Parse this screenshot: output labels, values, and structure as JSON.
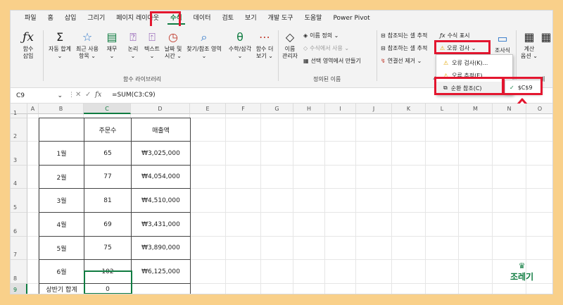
{
  "menu": [
    "파일",
    "홈",
    "삽입",
    "그리기",
    "페이지 레이아웃",
    "수식",
    "데이터",
    "검토",
    "보기",
    "개발 도구",
    "도움말",
    "Power Pivot"
  ],
  "active_menu": "수식",
  "ribbon": {
    "function_library": {
      "insert_function": [
        "함수",
        "삽입"
      ],
      "autosum": [
        "자동 합계",
        "⌄"
      ],
      "recent": [
        "최근 사용",
        "항목 ⌄"
      ],
      "financial": [
        "재무",
        "⌄"
      ],
      "logical": [
        "논리",
        "⌄"
      ],
      "text": [
        "텍스트",
        "⌄"
      ],
      "datetime": [
        "날짜 및",
        "시간 ⌄"
      ],
      "lookup": [
        "찾기/참조 영역",
        "⌄"
      ],
      "math": [
        "수학/삼각",
        "⌄"
      ],
      "more": [
        "함수 더",
        "보기 ⌄"
      ],
      "group_label": "함수 라이브러리"
    },
    "defined_names": {
      "name_manager": [
        "이름",
        "관리자"
      ],
      "define_name": "이름 정의 ⌄",
      "use_in_formula": "수식에서 사용 ⌄",
      "create_from_selection": "선택 영역에서 만들기",
      "group_label": "정의된 이름"
    },
    "auditing": {
      "trace_precedents": "참조되는 셀 추적",
      "trace_dependents": "참조하는 셀 추적",
      "remove_arrows": "연결선 제거 ⌄",
      "show_formulas": "수식 표시",
      "error_checking": "오류 검사 ⌄",
      "group_label_partial": "수"
    },
    "watch": "조사식",
    "calc_options": [
      "계산",
      "옵션 ⌄"
    ],
    "calc_group_label_partial": "계"
  },
  "error_dropdown": {
    "items": [
      "오류 검사(K)...",
      "오류 추적(E)",
      "순환 참조(C)"
    ],
    "submenu_arrow": "›",
    "circular_ref_cell": "$C$9"
  },
  "formula_bar": {
    "name_box": "C9",
    "fx": "fx",
    "formula": "=SUM(C3:C9)"
  },
  "columns": [
    "A",
    "B",
    "C",
    "D",
    "E",
    "F",
    "G",
    "H",
    "I",
    "J",
    "K",
    "L",
    "M",
    "N",
    "O"
  ],
  "rows": [
    "1",
    "2",
    "3",
    "4",
    "5",
    "6",
    "7",
    "8",
    "9"
  ],
  "table": {
    "headers": [
      "주문수",
      "매출액"
    ],
    "rows": [
      {
        "month": "1월",
        "orders": "65",
        "sales": "₩3,025,000"
      },
      {
        "month": "2월",
        "orders": "77",
        "sales": "₩4,054,000"
      },
      {
        "month": "3월",
        "orders": "81",
        "sales": "₩4,510,000"
      },
      {
        "month": "4월",
        "orders": "69",
        "sales": "₩3,431,000"
      },
      {
        "month": "5월",
        "orders": "75",
        "sales": "₩3,890,000"
      },
      {
        "month": "6월",
        "orders": "102",
        "sales": "₩6,125,000"
      }
    ],
    "total_label": "상반기 합계",
    "total_value": "0"
  },
  "watermark": "조레기",
  "colors": {
    "accent": "#107c41",
    "highlight": "#e3162f",
    "background": "#f9d08a"
  }
}
